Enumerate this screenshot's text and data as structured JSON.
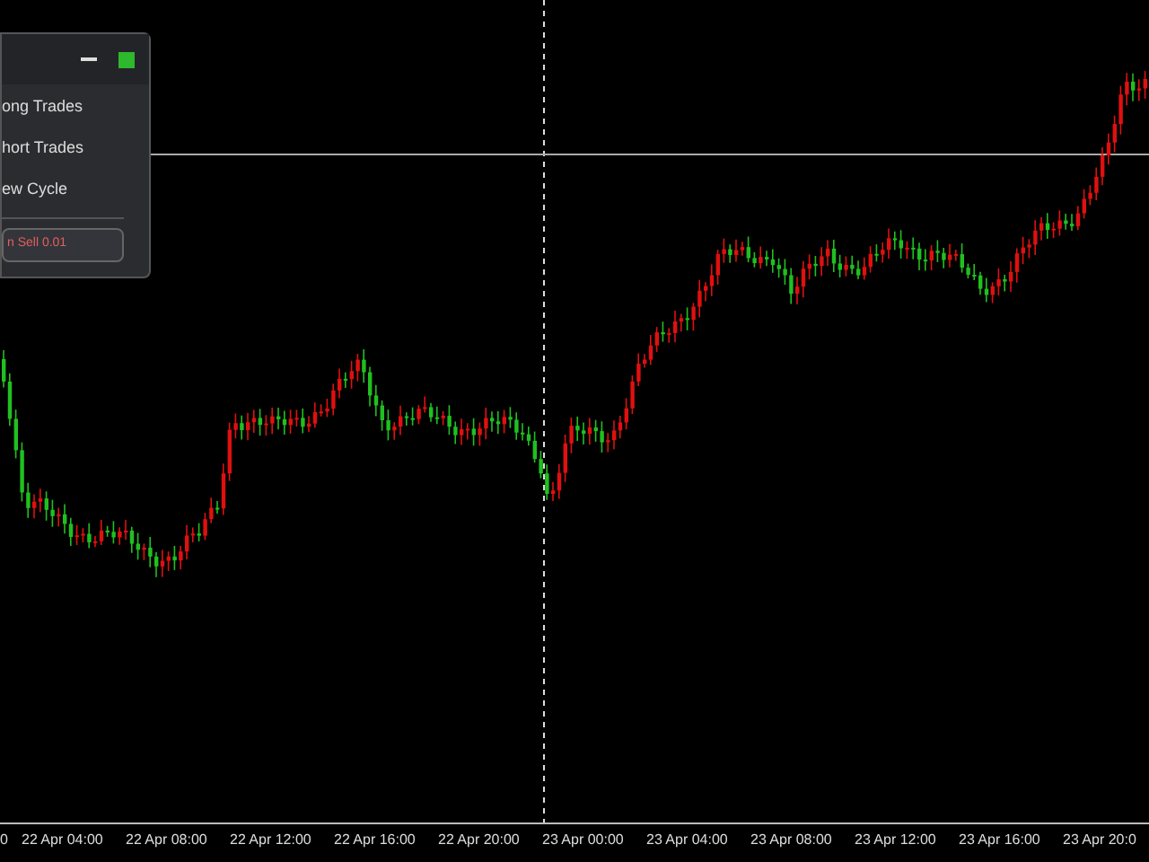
{
  "panel": {
    "items": [
      {
        "label": "ong Trades"
      },
      {
        "label": "hort Trades"
      },
      {
        "label": "ew Cycle"
      }
    ],
    "button": "n Sell 0.01"
  },
  "time_axis": {
    "labels": [
      "0",
      "22 Apr 04:00",
      "22 Apr 08:00",
      "22 Apr 12:00",
      "22 Apr 16:00",
      "22 Apr 20:00",
      "23 Apr 00:00",
      "23 Apr 04:00",
      "23 Apr 08:00",
      "23 Apr 12:00",
      "23 Apr 16:00",
      "23 Apr 20:0"
    ]
  }
}
